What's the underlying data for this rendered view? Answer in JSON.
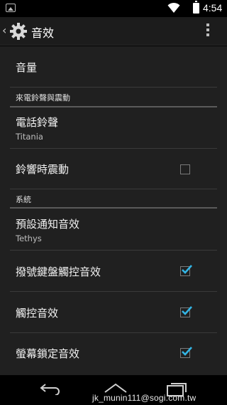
{
  "status_bar": {
    "time": "4:54",
    "icons": [
      "image-notification-icon",
      "wifi-icon",
      "battery-icon"
    ]
  },
  "action_bar": {
    "title": "音效",
    "icons": [
      "gear-icon",
      "overflow-menu-icon"
    ]
  },
  "settings": {
    "volume": {
      "title": "音量"
    },
    "ringtone_section": {
      "header": "來電鈴聲與震動"
    },
    "ringtone": {
      "title": "電話鈴聲",
      "summary": "Titania"
    },
    "vibrate_on_ring": {
      "title": "鈴響時震動",
      "checked": false
    },
    "system_section": {
      "header": "系統"
    },
    "default_notification": {
      "title": "預設通知音效",
      "summary": "Tethys"
    },
    "dial_pad_tones": {
      "title": "撥號鍵盤觸控音效",
      "checked": true
    },
    "touch_sounds": {
      "title": "觸控音效",
      "checked": true
    },
    "screen_lock_sounds": {
      "title": "螢幕鎖定音效",
      "checked": true
    }
  },
  "nav_bar": {
    "icons": [
      "back-icon",
      "home-icon",
      "recents-icon"
    ]
  },
  "watermark": "jk_munin111@sogi.com.tw",
  "colors": {
    "accent": "#33b5e5",
    "background": "#202020",
    "action_bar": "#1c1c1c"
  }
}
